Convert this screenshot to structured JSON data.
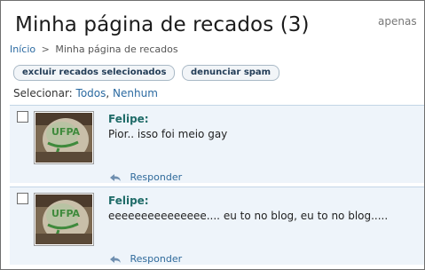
{
  "page": {
    "title": "Minha página de recados (3)",
    "corner_link": "apenas"
  },
  "breadcrumb": {
    "home": "Início",
    "separator": ">",
    "current": "Minha página de recados"
  },
  "toolbar": {
    "delete_label": "excluir recados selecionados",
    "spam_label": "denunciar spam"
  },
  "selection": {
    "label": "Selecionar:",
    "all": "Todos",
    "separator": ",",
    "none": "Nenhum"
  },
  "messages": [
    {
      "author": "Felipe:",
      "text": "Pior.. isso foi meio gay",
      "reply_label": "Responder"
    },
    {
      "author": "Felipe:",
      "text": "eeeeeeeeeeeeeee.... eu to no blog, eu to no blog.....",
      "reply_label": "Responder"
    }
  ],
  "colors": {
    "link": "#2b6aa1",
    "author": "#1f6b68",
    "message_bg": "#eef4fa"
  }
}
